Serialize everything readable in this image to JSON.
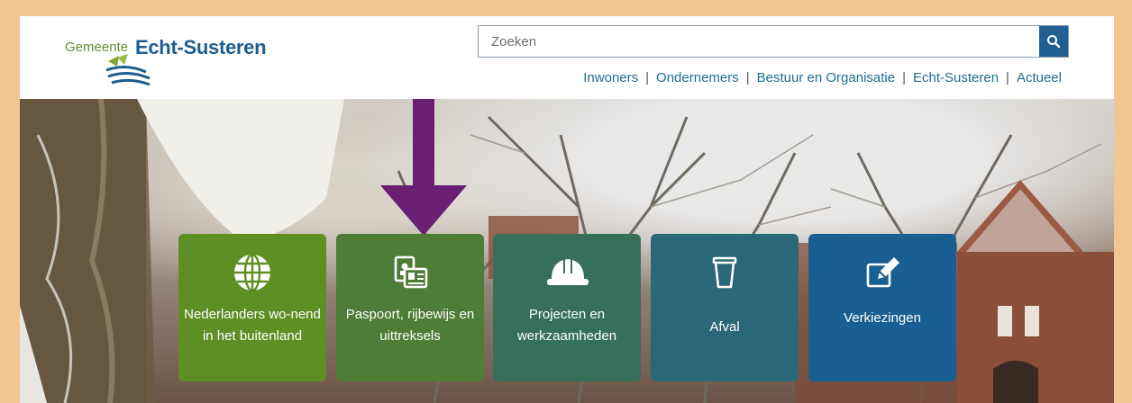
{
  "logo": {
    "small": "Gemeente",
    "big": "Echt-Susteren"
  },
  "search": {
    "placeholder": "Zoeken",
    "button_icon": "search-icon"
  },
  "nav": {
    "items": [
      "Inwoners",
      "Ondernemers",
      "Bestuur en Organisatie",
      "Echt-Susteren",
      "Actueel"
    ]
  },
  "annotation": {
    "arrow_color": "#6a1f73"
  },
  "tiles": [
    {
      "label": "Nederlanders wo-nend in het buitenland",
      "icon": "globe-icon",
      "color": "#5e8f24"
    },
    {
      "label": "Paspoort, rijbewijs en uittreksels",
      "icon": "id-card-icon",
      "color": "#4d7d36"
    },
    {
      "label": "Projecten en werkzaamheden",
      "icon": "hard-hat-icon",
      "color": "#37705a"
    },
    {
      "label": "Afval",
      "icon": "trash-bin-icon",
      "color": "#2a6778"
    },
    {
      "label": "Verkiezingen",
      "icon": "pencil-edit-icon",
      "color": "#1a5f92"
    }
  ]
}
